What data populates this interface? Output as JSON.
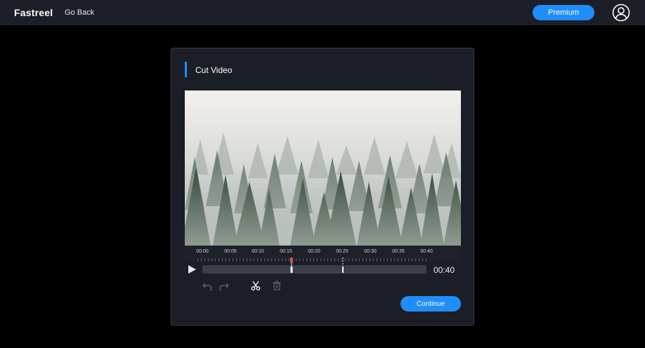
{
  "header": {
    "logo": "Fastreel",
    "go_back": "Go Back",
    "premium": "Premium",
    "user_icon": "user-circle-icon"
  },
  "panel": {
    "title": "Cut Video",
    "duration": "00:40",
    "continue": "Continue"
  },
  "timeline": {
    "labels": [
      "00:00",
      "00:05",
      "00:10",
      "00:15",
      "00:20",
      "00:25",
      "00:30",
      "00:35",
      "00:40"
    ],
    "playhead_color": "#e05050",
    "accent": "#1f8efa"
  },
  "tools": {
    "undo": "undo-icon",
    "redo": "redo-icon",
    "cut": "scissors-icon",
    "delete": "trash-icon"
  }
}
